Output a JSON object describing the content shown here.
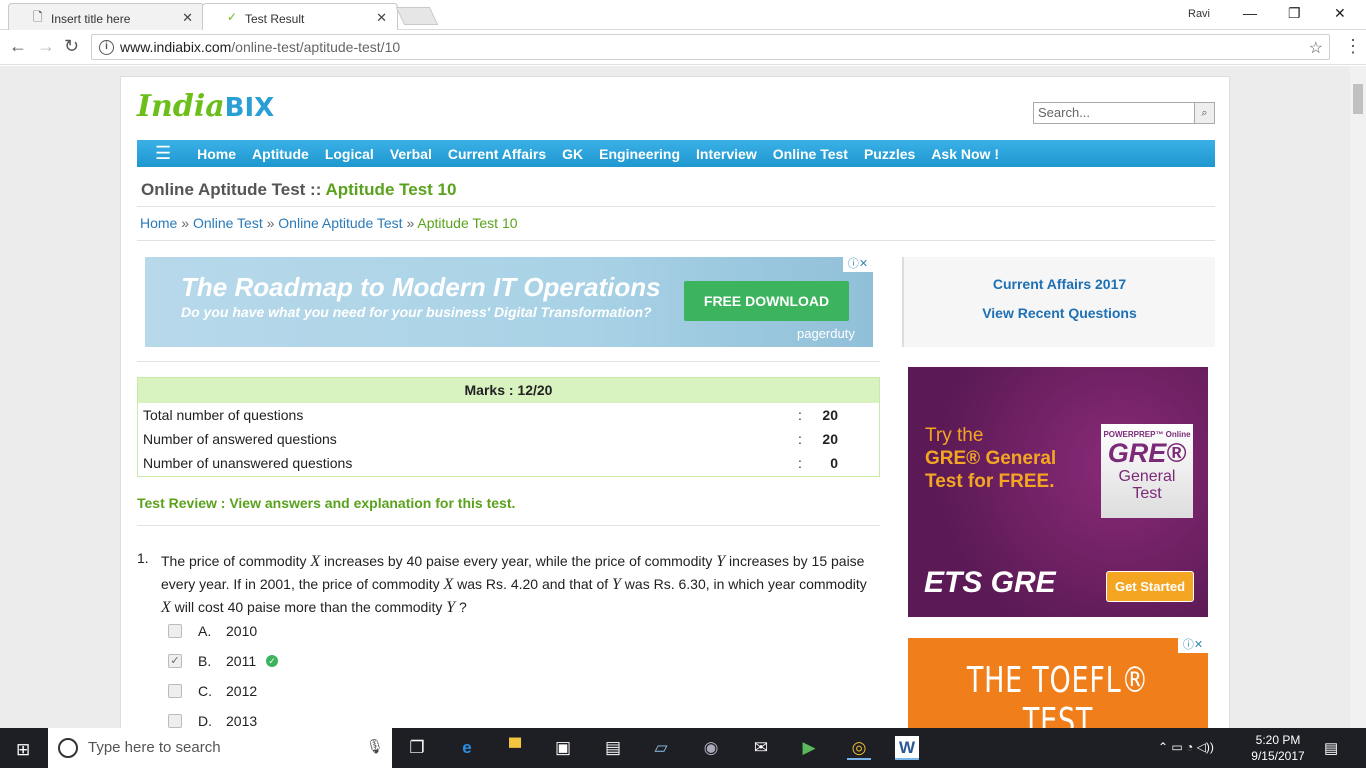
{
  "browser": {
    "tabs": [
      {
        "title": "Insert title here",
        "icon": "page-icon"
      },
      {
        "title": "Test Result",
        "icon": "indiabix-favicon"
      }
    ],
    "user": "Ravi",
    "window_controls": {
      "minimize": "—",
      "maximize": "❐",
      "close": "✕"
    },
    "url_host": "www.indiabix.com",
    "url_path": "/online-test/aptitude-test/10"
  },
  "site": {
    "logo_india": "India",
    "logo_bix": "BIX",
    "search_placeholder": "Search...",
    "nav": [
      "Home",
      "Aptitude",
      "Logical",
      "Verbal",
      "Current Affairs",
      "GK",
      "Engineering",
      "Interview",
      "Online Test",
      "Puzzles",
      "Ask Now !"
    ],
    "heading_prefix": "Online Aptitude Test :: ",
    "heading_highlight": "Aptitude Test 10",
    "breadcrumb": [
      {
        "label": "Home"
      },
      {
        "label": "Online Test"
      },
      {
        "label": "Online Aptitude Test"
      },
      {
        "label": "Aptitude Test 10"
      }
    ],
    "breadcrumb_sep": " » "
  },
  "ad_top": {
    "title": "The Roadmap to Modern IT Operations",
    "subtitle": "Do you have what you need for your business' Digital Transformation?",
    "button": "FREE DOWNLOAD",
    "brand": "pagerduty",
    "adchoice": "ⓘ✕"
  },
  "sidebar_links": [
    "Current Affairs 2017",
    "View Recent Questions"
  ],
  "marks": {
    "title": "Marks : 12/20",
    "rows": [
      {
        "label": "Total number of questions",
        "sep": ":",
        "value": "20"
      },
      {
        "label": "Number of answered questions",
        "sep": ":",
        "value": "20"
      },
      {
        "label": "Number of unanswered questions",
        "sep": ":",
        "value": "0"
      }
    ]
  },
  "review_title": "Test Review : View answers and explanation for this test.",
  "question": {
    "number": "1.",
    "text_parts": [
      "The price of commodity ",
      "X",
      " increases by 40 paise every year, while the price of commodity ",
      "Y",
      " increases by 15 paise every year. If in 2001, the price of commodity ",
      "X",
      " was Rs. 4.20 and that of ",
      "Y",
      " was Rs. 6.30, in which year commodity ",
      "X",
      " will cost 40 paise more than the commodity ",
      "Y",
      " ?"
    ],
    "options": [
      {
        "letter": "A.",
        "value": "2010",
        "checked": false,
        "correct": false
      },
      {
        "letter": "B.",
        "value": "2011",
        "checked": true,
        "correct": true
      },
      {
        "letter": "C.",
        "value": "2012",
        "checked": false,
        "correct": false
      },
      {
        "letter": "D.",
        "value": "2013",
        "checked": false,
        "correct": false
      }
    ]
  },
  "ad_gre": {
    "line1": "Try the",
    "line2": "GRE® General",
    "line3": "Test for FREE.",
    "box_small": "POWERPREP™ Online",
    "box_big": "GRE®",
    "box_sub1": "General",
    "box_sub2": "Test",
    "logo": "ETS GRE",
    "button": "Get Started"
  },
  "ad_toefl": {
    "title": "THE TOEFL® TEST",
    "adchoice": "ⓘ✕"
  },
  "taskbar": {
    "search_placeholder": "Type here to search",
    "time": "5:20 PM",
    "date": "9/15/2017"
  }
}
